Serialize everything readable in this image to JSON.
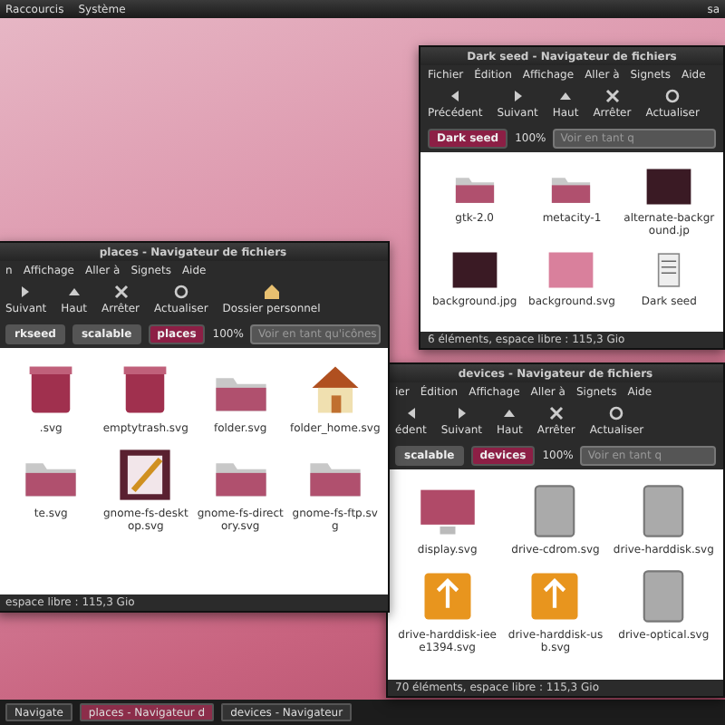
{
  "top_panel": {
    "menus": [
      "Raccourcis",
      "Système"
    ],
    "user": "sa"
  },
  "windows": [
    {
      "title": "Dark seed - Navigateur de fichiers",
      "menu": [
        "Fichier",
        "Édition",
        "Affichage",
        "Aller à",
        "Signets",
        "Aide"
      ],
      "toolbar": [
        {
          "label": "Précédent",
          "kind": "back"
        },
        {
          "label": "Suivant",
          "kind": "forward"
        },
        {
          "label": "Haut",
          "kind": "up"
        },
        {
          "label": "Arrêter",
          "kind": "stop"
        },
        {
          "label": "Actualiser",
          "kind": "reload"
        }
      ],
      "location": {
        "crumbs": [
          {
            "label": "Dark seed",
            "selected": true
          }
        ],
        "zoom": "100%",
        "view": "Voir en tant q"
      },
      "files": [
        {
          "name": "gtk-2.0",
          "kind": "folder"
        },
        {
          "name": "metacity-1",
          "kind": "folder"
        },
        {
          "name": "alternate-background.jp",
          "kind": "photo"
        },
        {
          "name": "background.jpg",
          "kind": "photo"
        },
        {
          "name": "background.svg",
          "kind": "pink"
        },
        {
          "name": "Dark seed",
          "kind": "document"
        }
      ],
      "status": "6 éléments, espace libre : 115,3 Gio"
    },
    {
      "title": "places - Navigateur de fichiers",
      "menu": [
        "n",
        "Affichage",
        "Aller à",
        "Signets",
        "Aide"
      ],
      "toolbar": [
        {
          "label": "Suivant",
          "kind": "forward"
        },
        {
          "label": "Haut",
          "kind": "up"
        },
        {
          "label": "Arrêter",
          "kind": "stop"
        },
        {
          "label": "Actualiser",
          "kind": "reload"
        },
        {
          "label": "Dossier personnel",
          "kind": "home"
        }
      ],
      "location": {
        "crumbs": [
          {
            "label": "rkseed",
            "selected": false
          },
          {
            "label": "scalable",
            "selected": false
          },
          {
            "label": "places",
            "selected": true
          }
        ],
        "zoom": "100%",
        "view": "Voir en tant qu'icônes"
      },
      "files": [
        {
          "name": ".svg",
          "kind": "trash"
        },
        {
          "name": "emptytrash.svg",
          "kind": "trash"
        },
        {
          "name": "folder.svg",
          "kind": "folder"
        },
        {
          "name": "folder_home.svg",
          "kind": "home"
        },
        {
          "name": "te.svg",
          "kind": "folder"
        },
        {
          "name": "gnome-fs-desktop.svg",
          "kind": "desktop"
        },
        {
          "name": "gnome-fs-directory.svg",
          "kind": "folder"
        },
        {
          "name": "gnome-fs-ftp.svg",
          "kind": "folder"
        }
      ],
      "status": "espace libre : 115,3 Gio"
    },
    {
      "title": "devices - Navigateur de fichiers",
      "menu": [
        "ier",
        "Édition",
        "Affichage",
        "Aller à",
        "Signets",
        "Aide"
      ],
      "toolbar": [
        {
          "label": "édent",
          "kind": "back"
        },
        {
          "label": "Suivant",
          "kind": "forward"
        },
        {
          "label": "Haut",
          "kind": "up"
        },
        {
          "label": "Arrêter",
          "kind": "stop"
        },
        {
          "label": "Actualiser",
          "kind": "reload"
        }
      ],
      "location": {
        "crumbs": [
          {
            "label": "scalable",
            "selected": false
          },
          {
            "label": "devices",
            "selected": true
          }
        ],
        "zoom": "100%",
        "view": "Voir en tant q"
      },
      "files": [
        {
          "name": "display.svg",
          "kind": "display"
        },
        {
          "name": "drive-cdrom.svg",
          "kind": "drive"
        },
        {
          "name": "drive-harddisk.svg",
          "kind": "drive"
        },
        {
          "name": "drive-harddisk-ieee1394.svg",
          "kind": "orange"
        },
        {
          "name": "drive-harddisk-usb.svg",
          "kind": "orange"
        },
        {
          "name": "drive-optical.svg",
          "kind": "drive"
        }
      ],
      "status": "70 éléments, espace libre : 115,3 Gio"
    }
  ],
  "taskbar": [
    {
      "label": "Navigate",
      "selected": false
    },
    {
      "label": "places - Navigateur d",
      "selected": true
    },
    {
      "label": "devices - Navigateur",
      "selected": false
    }
  ]
}
